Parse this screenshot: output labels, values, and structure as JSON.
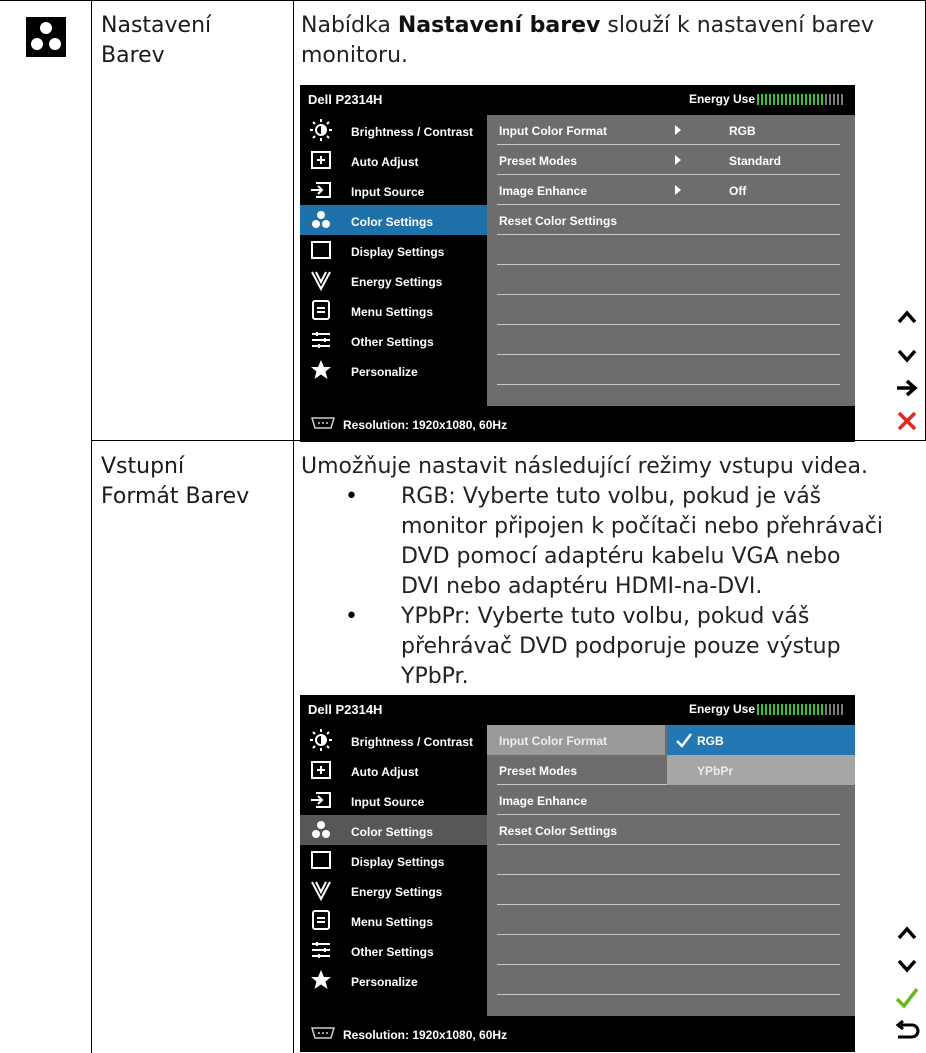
{
  "row1": {
    "setting_name": [
      "Nastavení",
      "Barev"
    ],
    "description": {
      "prefix": "Nabídka ",
      "bold": "Nastavení barev",
      "suffix": " slouží k nastavení barev",
      "line2": "monitoru."
    }
  },
  "row2": {
    "setting_name": [
      "Vstupní",
      "Formát Barev"
    ],
    "intro": "Umožňuje nastavit následující režimy vstupu videa.",
    "bullets": [
      [
        "RGB: Vyberte tuto volbu, pokud je váš",
        "monitor připojen k počítači nebo přehrávači",
        "DVD pomocí adaptéru kabelu VGA nebo",
        "DVI nebo adaptéru HDMI-na-DVI."
      ],
      [
        "YPbPr: Vyberte tuto volbu, pokud váš",
        "přehrávač DVD podporuje pouze výstup",
        "YPbPr."
      ]
    ]
  },
  "osd": {
    "model": "Dell P2314H",
    "energy_label": "Energy Use",
    "resolution": "Resolution: 1920x1080, 60Hz",
    "menu": [
      {
        "label": "Brightness / Contrast",
        "icon": "brightness-icon"
      },
      {
        "label": "Auto Adjust",
        "icon": "auto-adjust-icon"
      },
      {
        "label": "Input Source",
        "icon": "input-source-icon"
      },
      {
        "label": "Color Settings",
        "icon": "color-settings-icon"
      },
      {
        "label": "Display Settings",
        "icon": "display-settings-icon"
      },
      {
        "label": "Energy Settings",
        "icon": "energy-settings-icon"
      },
      {
        "label": "Menu Settings",
        "icon": "menu-settings-icon"
      },
      {
        "label": "Other Settings",
        "icon": "other-settings-icon"
      },
      {
        "label": "Personalize",
        "icon": "star-icon"
      }
    ],
    "submenu": [
      {
        "label": "Input Color Format",
        "value": "RGB"
      },
      {
        "label": "Preset Modes",
        "value": "Standard"
      },
      {
        "label": "Image Enhance",
        "value": "Off"
      },
      {
        "label": "Reset Color Settings",
        "value": ""
      }
    ],
    "options": [
      "RGB",
      "YPbPr"
    ]
  },
  "colors": {
    "selected": "#1f72a9",
    "panel": "#6d6d6d",
    "meter_green": "#39c23a",
    "close_red": "#e0281e",
    "check_green": "#6ab820"
  }
}
